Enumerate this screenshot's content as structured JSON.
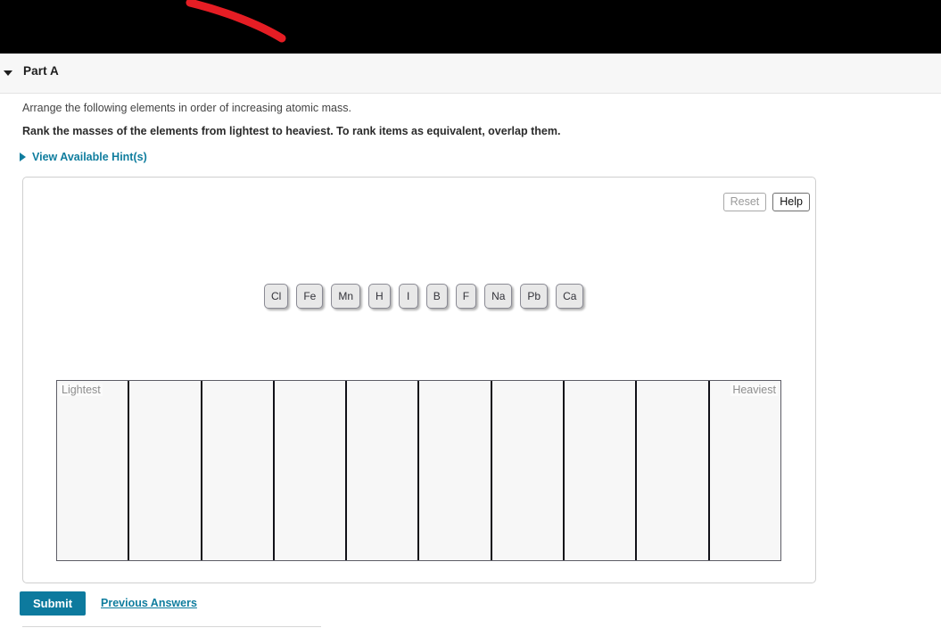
{
  "banner": {
    "annotation_color": "#e51d24",
    "background": "#000000"
  },
  "part_header": {
    "title": "Part A",
    "toggle_icon": "triangle-down-icon"
  },
  "question": {
    "prompt": "Arrange the following elements in order of increasing atomic mass.",
    "instruction": "Rank the masses of the elements from lightest to heaviest. To rank items as equivalent, overlap them."
  },
  "hints": {
    "label": "View Available Hint(s)",
    "icon": "triangle-right-icon",
    "color": "#0f7d9e"
  },
  "panel": {
    "reset_label": "Reset",
    "help_label": "Help",
    "tiles": [
      {
        "label": "Cl"
      },
      {
        "label": "Fe"
      },
      {
        "label": "Mn"
      },
      {
        "label": "H"
      },
      {
        "label": "I"
      },
      {
        "label": "B"
      },
      {
        "label": "F"
      },
      {
        "label": "Na"
      },
      {
        "label": "Pb"
      },
      {
        "label": "Ca"
      }
    ],
    "ranking": {
      "left_tag": "Lightest",
      "right_tag": "Heaviest",
      "bin_count": 10,
      "bins": [
        {
          "content": ""
        },
        {
          "content": ""
        },
        {
          "content": ""
        },
        {
          "content": ""
        },
        {
          "content": ""
        },
        {
          "content": ""
        },
        {
          "content": ""
        },
        {
          "content": ""
        },
        {
          "content": ""
        },
        {
          "content": ""
        }
      ]
    }
  },
  "footer": {
    "submit_label": "Submit",
    "previous_answers_label": "Previous Answers",
    "submit_color": "#0d7a9e"
  }
}
